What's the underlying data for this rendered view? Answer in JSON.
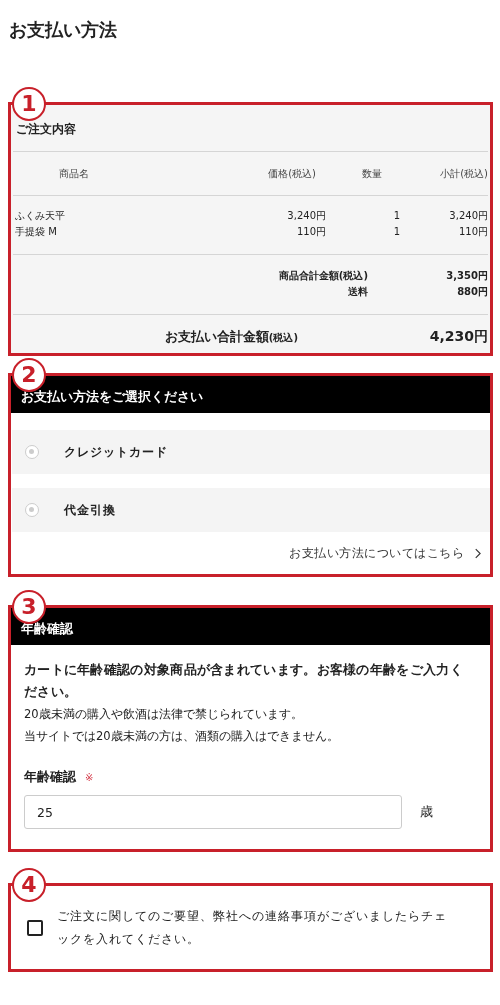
{
  "title": "お支払い方法",
  "order_summary": {
    "annotation": "1",
    "heading": "ご注文内容",
    "columns": [
      {
        "label": "商品名"
      },
      {
        "label": "価格",
        "note": "(税込)"
      },
      {
        "label": "数量"
      },
      {
        "label": "小計",
        "note": "(税込)"
      }
    ],
    "rows": [
      {
        "name": "ふくみ天平",
        "price": "3,240円",
        "quantity": "1",
        "subtotal": "3,240円"
      },
      {
        "name": "手提袋 M",
        "price": "110円",
        "quantity": "1",
        "subtotal": "110円"
      }
    ],
    "totals": [
      {
        "label": "商品合計金額",
        "note": "(税込)",
        "value": "3,350円"
      },
      {
        "label": "送料",
        "value": "880円"
      }
    ],
    "grand_total": {
      "label": "お支払い合計金額",
      "note": "(税込)",
      "value": "4,230円"
    }
  },
  "payment": {
    "annotation": "2",
    "heading": "お支払い方法をご選択ください",
    "options": [
      {
        "label": "クレジットカード",
        "selected": false
      },
      {
        "label": "代金引換",
        "selected": false
      }
    ],
    "link": "お支払い方法についてはこちら"
  },
  "age_check": {
    "annotation": "3",
    "heading": "年齢確認",
    "notice": "カートに年齢確認の対象商品が含まれています。お客様の年齢をご入力ください。",
    "notes": [
      "20歳未満の購入や飲酒は法律で禁じられています。",
      "当サイトでは20歳未満の方は、酒類の購入はできません。"
    ],
    "field_label": "年齢確認",
    "required_mark": "※",
    "value": "25",
    "unit": "歳"
  },
  "request": {
    "annotation": "4",
    "checked": false,
    "label": "ご注文に関してのご要望、弊社への連絡事項がございましたらチェックを入れてください。"
  }
}
